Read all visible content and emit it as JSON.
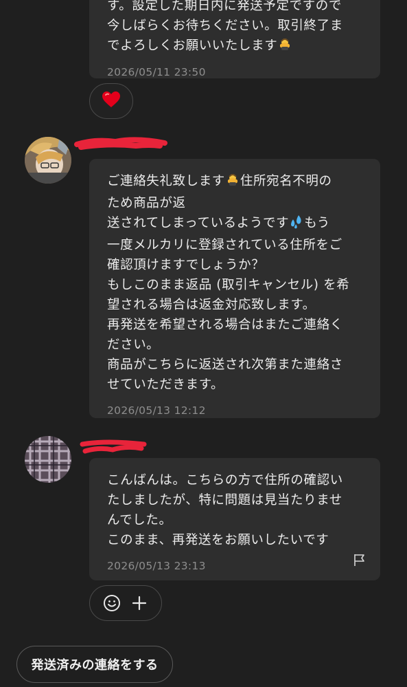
{
  "messages": [
    {
      "lines": [
        "す。設定した期日内に発送予定ですので",
        "今しばらくお待ちください。取引終了ま",
        "でよろしくお願いいたします"
      ],
      "timestamp": "2026/05/11 23:50",
      "reaction_icon": "red-heart-icon"
    },
    {
      "lines": [
        "ご連絡失礼致します",
        "住所宛名不明の",
        "ため商品が返",
        "送されてしまっているようです",
        "もう",
        "一度メルカリに登録されている住所をご",
        "確認頂けますでしょうか？",
        "もしこのまま返品 (取引キャンセル) を希",
        "望される場合は返金対応致します。",
        "再発送を希望される場合はまたご連絡く",
        "ださい。",
        "商品がこちらに返送され次第また連絡さ",
        "せていただきます。"
      ],
      "timestamp": "2026/05/13 12:12"
    },
    {
      "lines": [
        "こんばんは。こちらの方で住所の確認い",
        "たしましたが、特に問題は見当たりませ",
        "んでした。",
        "このまま、再発送をお願いしたいです"
      ],
      "timestamp": "2026/05/13 23:13"
    }
  ],
  "actions": {
    "emoji_icon": "smiley-icon",
    "add_icon": "plus-icon",
    "report_icon": "flag-icon"
  },
  "ship_button_label": "発送済みの連絡をする",
  "colors": {
    "background": "#1f1f1f",
    "bubble": "#2e2e2e",
    "redaction": "#e8243a",
    "heart": "#e3001b"
  }
}
